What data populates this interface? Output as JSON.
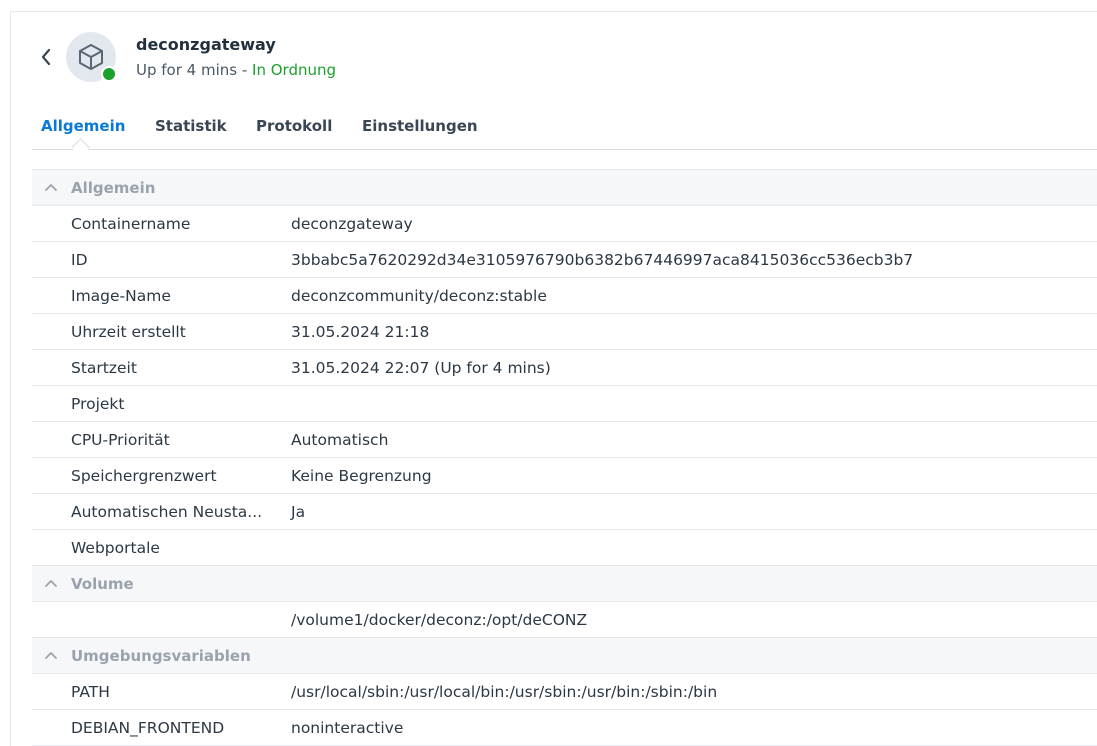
{
  "header": {
    "title": "deconzgateway",
    "status_text": "Up for 4 mins",
    "status_sep": " - ",
    "status_ok": "In Ordnung",
    "status_color": "#1ca02d",
    "avatar_icon": "cube-icon",
    "back_icon": "chevron-left-icon"
  },
  "tabs": [
    {
      "label": "Allgemein",
      "active": true
    },
    {
      "label": "Statistik",
      "active": false
    },
    {
      "label": "Protokoll",
      "active": false
    },
    {
      "label": "Einstellungen",
      "active": false
    }
  ],
  "sections": {
    "general": {
      "title": "Allgemein",
      "rows": [
        {
          "label": "Containername",
          "value": "deconzgateway"
        },
        {
          "label": "ID",
          "value": "3bbabc5a7620292d34e3105976790b6382b67446997aca8415036cc536ecb3b7"
        },
        {
          "label": "Image-Name",
          "value": "deconzcommunity/deconz:stable"
        },
        {
          "label": "Uhrzeit erstellt",
          "value": "31.05.2024 21:18"
        },
        {
          "label": "Startzeit",
          "value": "31.05.2024 22:07 (Up for 4 mins)"
        },
        {
          "label": "Projekt",
          "value": ""
        },
        {
          "label": "CPU-Priorität",
          "value": "Automatisch"
        },
        {
          "label": "Speichergrenzwert",
          "value": "Keine Begrenzung"
        },
        {
          "label": "Automatischen Neusta...",
          "value": "Ja"
        },
        {
          "label": "Webportale",
          "value": ""
        }
      ]
    },
    "volume": {
      "title": "Volume",
      "rows": [
        {
          "label": "",
          "value": "/volume1/docker/deconz:/opt/deCONZ"
        }
      ]
    },
    "env": {
      "title": "Umgebungsvariablen",
      "rows": [
        {
          "label": "PATH",
          "value": "/usr/local/sbin:/usr/local/bin:/usr/sbin:/usr/bin:/sbin:/bin"
        },
        {
          "label": "DEBIAN_FRONTEND",
          "value": "noninteractive"
        }
      ]
    }
  }
}
